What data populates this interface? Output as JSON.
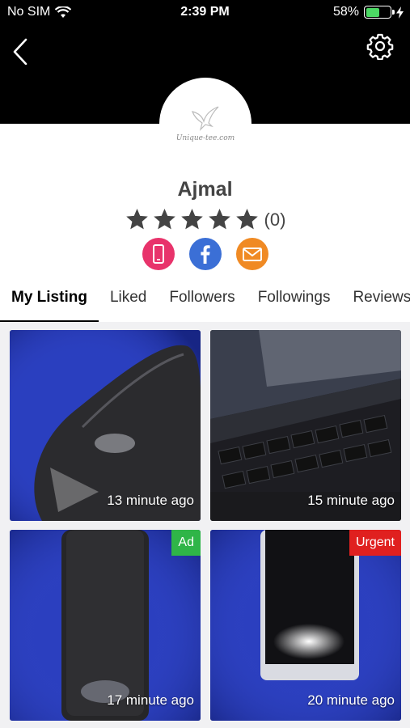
{
  "status_bar": {
    "carrier": "No SIM",
    "time": "2:39 PM",
    "battery": "58%",
    "battery_level": 0.58
  },
  "profile": {
    "avatar_text": "Unique-tee.com",
    "name": "Ajmal",
    "rating_stars": 5,
    "rating_count": "(0)"
  },
  "contacts": [
    {
      "icon": "phone-icon",
      "color": "#e8336b"
    },
    {
      "icon": "facebook-icon",
      "color": "#3b6fd6"
    },
    {
      "icon": "email-icon",
      "color": "#f08a24"
    }
  ],
  "tabs": [
    "My Listing",
    "Liked",
    "Followers",
    "Followings",
    "Reviews"
  ],
  "listings": [
    {
      "time": "13 minute ago",
      "badge": "",
      "image": "mouse"
    },
    {
      "time": "15 minute ago",
      "badge": "",
      "image": "laptop"
    },
    {
      "time": "17 minute ago",
      "badge": "Ad",
      "badge_color": "#2fb548",
      "image": "phone-back"
    },
    {
      "time": "20 minute ago",
      "badge": "Urgent",
      "badge_color": "#e0201f",
      "image": "phone-front"
    }
  ]
}
